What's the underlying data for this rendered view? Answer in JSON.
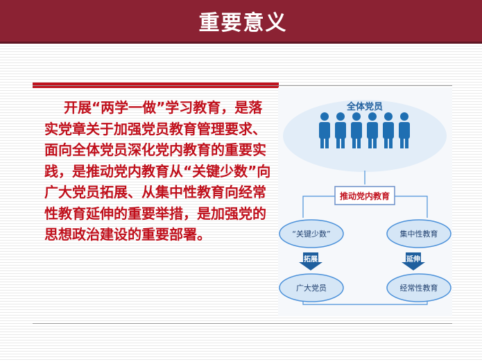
{
  "header": {
    "title": "重要意义"
  },
  "main": {
    "paragraph": "开展“两学一做”学习教育，是落实党章关于加强党员教育管理要求、面向全体党员深化党内教育的重要实践，是推动党内教育从“关键少数”向广大党员拓展、从集中性教育向经常性教育延伸的重要举措，是加强党的思想政治建设的重要部署。"
  },
  "diagram": {
    "top_label": "全体党员",
    "center_label": "推动党内教育",
    "left_top": "“关键少数”",
    "left_bottom": "广大党员",
    "left_arrow": "拓展",
    "right_top": "集中性教育",
    "right_bottom": "经常性教育",
    "right_arrow": "延伸"
  },
  "colors": {
    "header_bg": "#8b2233",
    "accent_red": "#c00f1b",
    "person_blue": "#1f6fb2",
    "ellipse_fill": "#d5e6f6",
    "ellipse_stroke": "#4a90d9"
  }
}
